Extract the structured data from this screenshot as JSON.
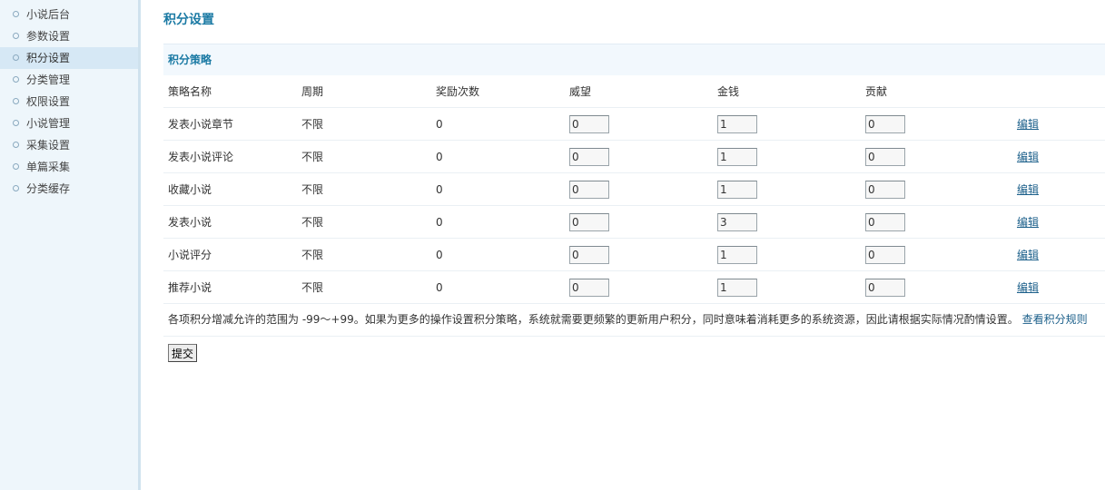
{
  "sidebar": {
    "items": [
      {
        "label": "小说后台"
      },
      {
        "label": "参数设置"
      },
      {
        "label": "积分设置"
      },
      {
        "label": "分类管理"
      },
      {
        "label": "权限设置"
      },
      {
        "label": "小说管理"
      },
      {
        "label": "采集设置"
      },
      {
        "label": "单篇采集"
      },
      {
        "label": "分类缓存"
      }
    ],
    "active_label": "积分设置"
  },
  "page": {
    "title": "积分设置",
    "section_title": "积分策略"
  },
  "table": {
    "headers": [
      "策略名称",
      "周期",
      "奖励次数",
      "威望",
      "金钱",
      "贡献",
      ""
    ],
    "rows": [
      {
        "name": "发表小说章节",
        "period": "不限",
        "count": "0",
        "prestige": "0",
        "money": "1",
        "contribution": "0",
        "action": "编辑"
      },
      {
        "name": "发表小说评论",
        "period": "不限",
        "count": "0",
        "prestige": "0",
        "money": "1",
        "contribution": "0",
        "action": "编辑"
      },
      {
        "name": "收藏小说",
        "period": "不限",
        "count": "0",
        "prestige": "0",
        "money": "1",
        "contribution": "0",
        "action": "编辑"
      },
      {
        "name": "发表小说",
        "period": "不限",
        "count": "0",
        "prestige": "0",
        "money": "3",
        "contribution": "0",
        "action": "编辑"
      },
      {
        "name": "小说评分",
        "period": "不限",
        "count": "0",
        "prestige": "0",
        "money": "1",
        "contribution": "0",
        "action": "编辑"
      },
      {
        "name": "推荐小说",
        "period": "不限",
        "count": "0",
        "prestige": "0",
        "money": "1",
        "contribution": "0",
        "action": "编辑"
      }
    ]
  },
  "note": {
    "text": "各项积分增减允许的范围为 -99～+99。如果为更多的操作设置积分策略，系统就需要更频繁的更新用户积分，同时意味着消耗更多的系统资源，因此请根据实际情况酌情设置。",
    "link": "查看积分规则"
  },
  "form": {
    "submit_label": "提交"
  },
  "colors": {
    "accent": "#1b7aa4",
    "sidebar_bg": "#eef6fb",
    "active_item_bg": "#d6e8f5",
    "link": "#1b5f8a"
  }
}
